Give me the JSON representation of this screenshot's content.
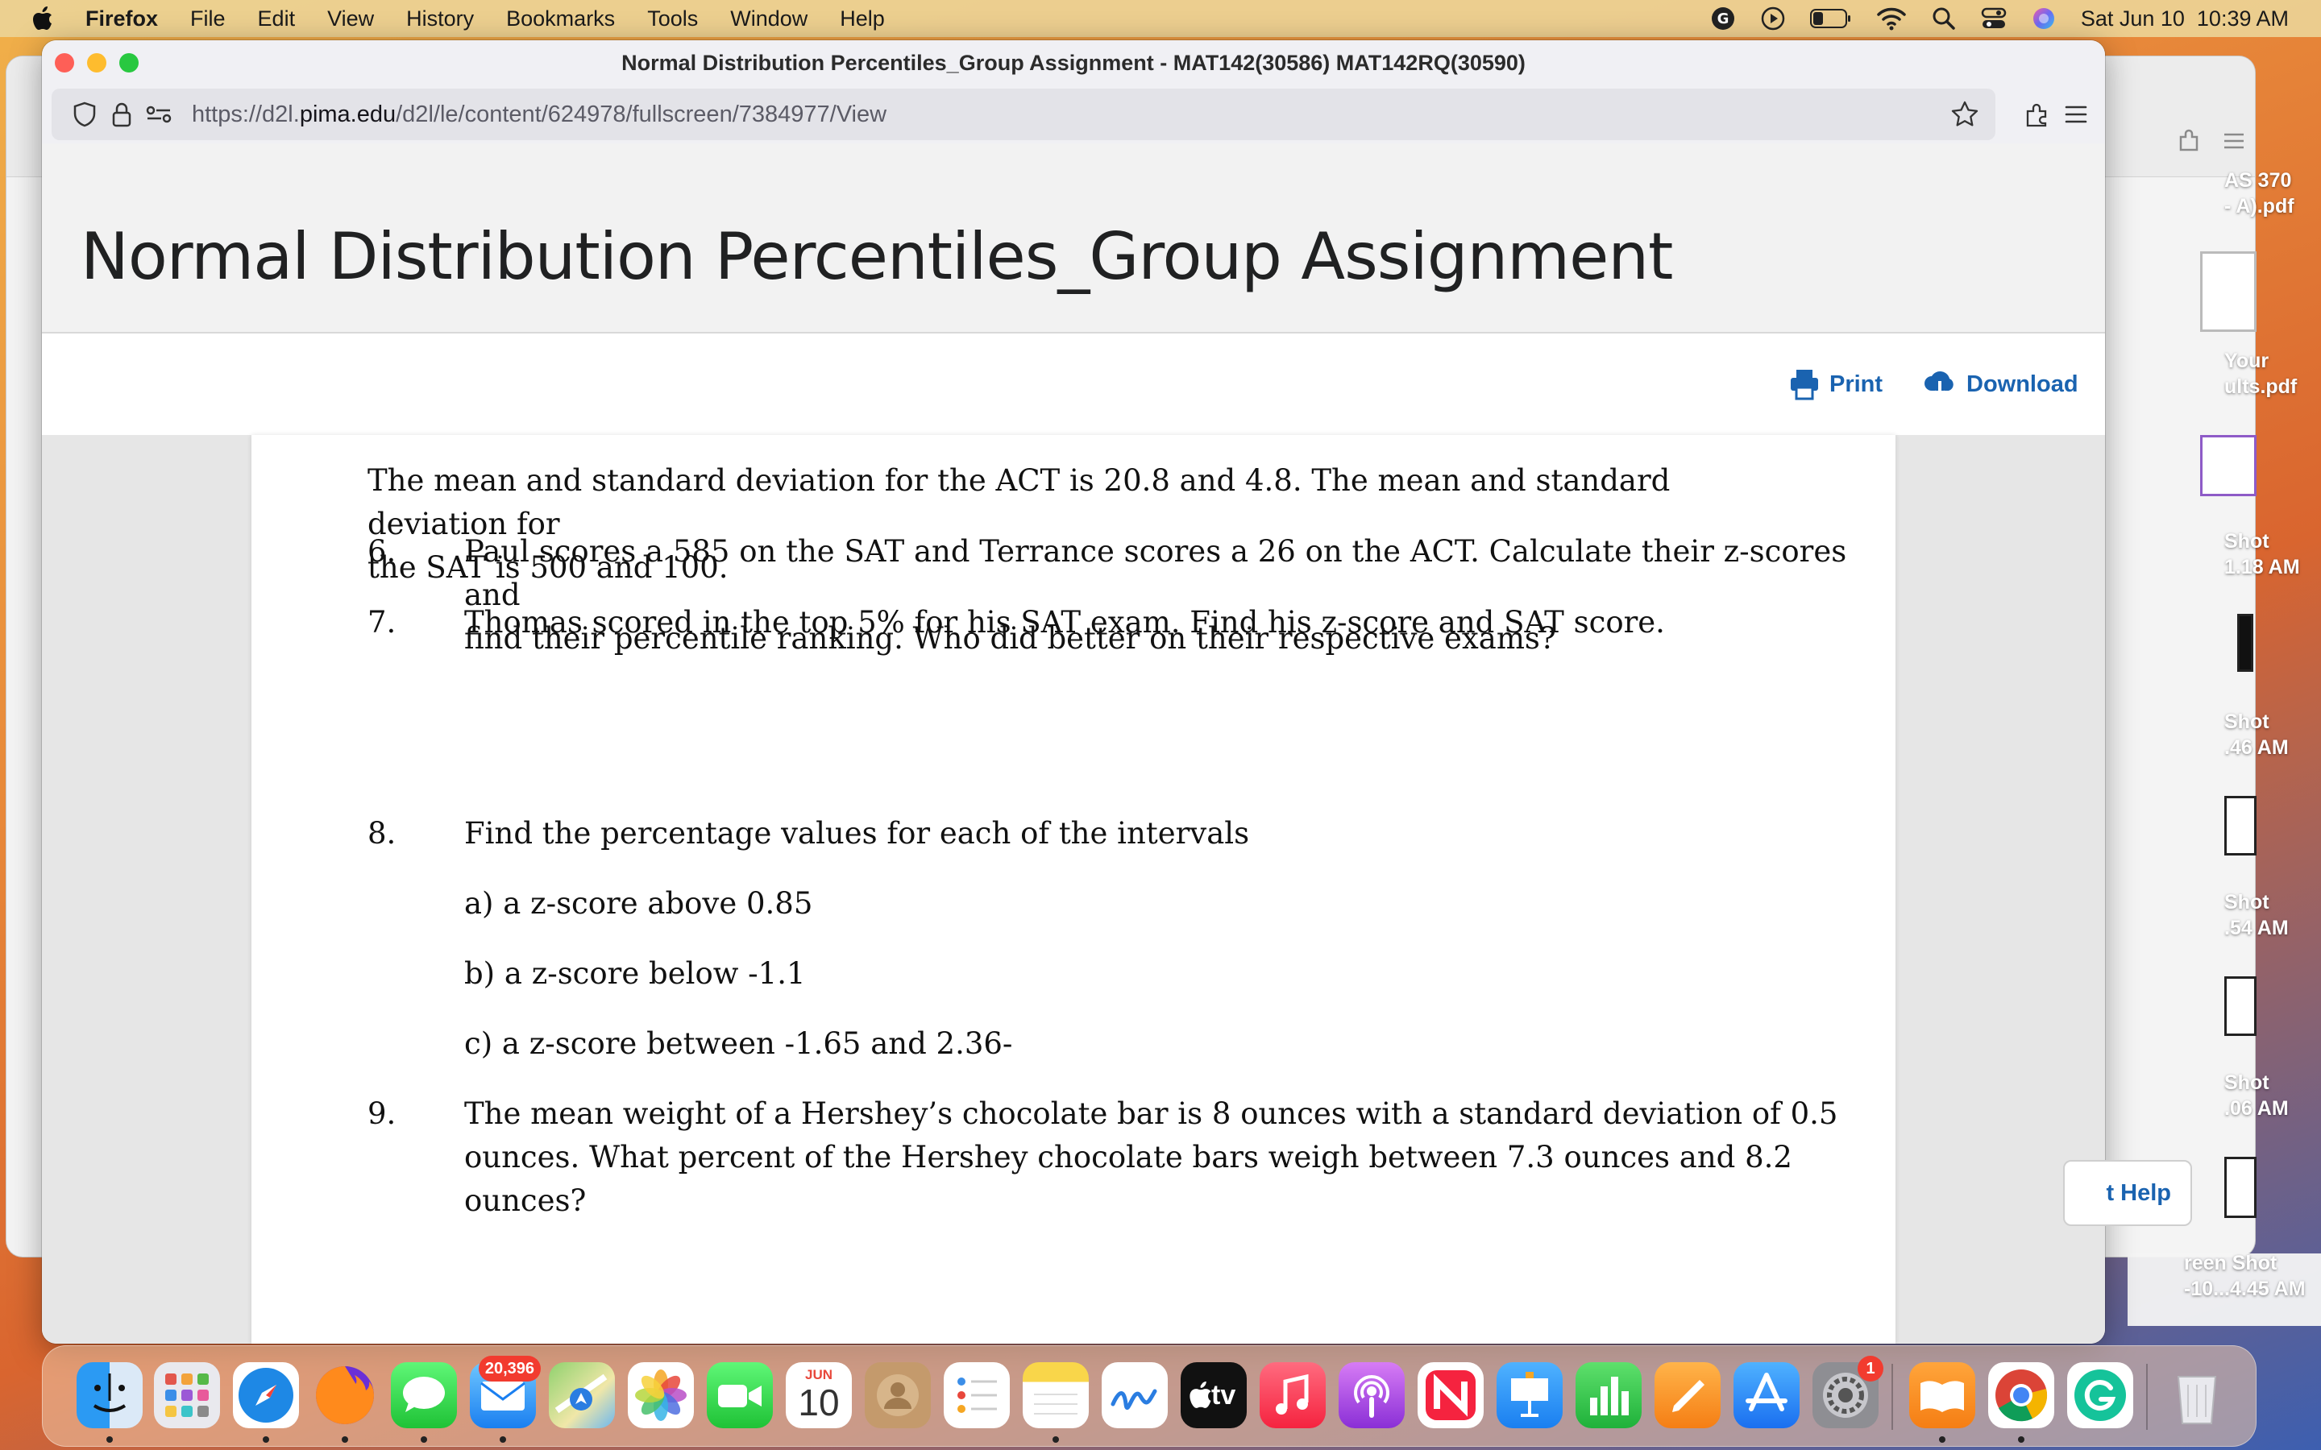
{
  "menubar": {
    "app_name": "Firefox",
    "items": [
      "File",
      "Edit",
      "View",
      "History",
      "Bookmarks",
      "Tools",
      "Window",
      "Help"
    ],
    "clock": "Sat Jun 10  10:39 AM"
  },
  "browser": {
    "window_title": "Normal Distribution Percentiles_Group Assignment - MAT142(30586) MAT142RQ(30590)",
    "url_prefix": "https://d2l.",
    "url_host": "pima.edu",
    "url_path": "/d2l/le/content/624978/fullscreen/7384977/View"
  },
  "page": {
    "title": "Normal Distribution Percentiles_Group Assignment",
    "print_label": "Print",
    "download_label": "Download"
  },
  "document": {
    "intro_line1": "The mean and standard deviation for the ACT is 20.8 and 4.8.  The mean and standard deviation for",
    "intro_line2": "the SAT is 500 and 100.",
    "questions": [
      {
        "number": "6.",
        "line1": "Paul scores a 585 on the SAT and Terrance scores a 26 on the ACT.  Calculate their z-scores and",
        "line2": "find their percentile ranking.  Who did better on their respective exams?"
      },
      {
        "number": "7.",
        "line1": "Thomas scored in the top 5% for his SAT exam.  Find his z-score and SAT score."
      },
      {
        "number": "8.",
        "line1": "Find the percentage values for each of the intervals",
        "parts": [
          "a)  a z-score  above  0.85",
          "b)  a z-score below -1.1",
          "c)  a z-score between -1.65 and 2.36-"
        ]
      },
      {
        "number": "9.",
        "line1": "The mean weight of a Hershey’s chocolate bar is 8 ounces with a standard deviation  of 0.5",
        "line2": "ounces.  What percent of the Hershey chocolate bars weigh between 7.3 ounces and 8.2 ounces?"
      }
    ]
  },
  "help_button": {
    "label": "t Help"
  },
  "desktop_labels": [
    {
      "line1": "AS 370",
      "line2": "- A).pdf"
    },
    {
      "line1": "Your",
      "line2": "ults.pdf"
    },
    {
      "line1": "Shot",
      "line2": "1.18 AM"
    },
    {
      "line1": "Shot",
      "line2": ".46 AM"
    },
    {
      "line1": "Shot",
      "line2": ".54 AM"
    },
    {
      "line1": "Shot",
      "line2": ".06 AM"
    },
    {
      "line1": "reen Shot",
      "line2": "-10...4.45 AM"
    }
  ],
  "dock": {
    "mail_badge": "20,396",
    "calendar_month": "JUN",
    "calendar_day": "10",
    "appletv_label": "tv",
    "settings_badge": "1"
  },
  "colors": {
    "link_blue": "#1a63b0",
    "traffic_red": "#fe5f57",
    "traffic_yellow": "#febc2e",
    "traffic_green": "#28c840"
  }
}
